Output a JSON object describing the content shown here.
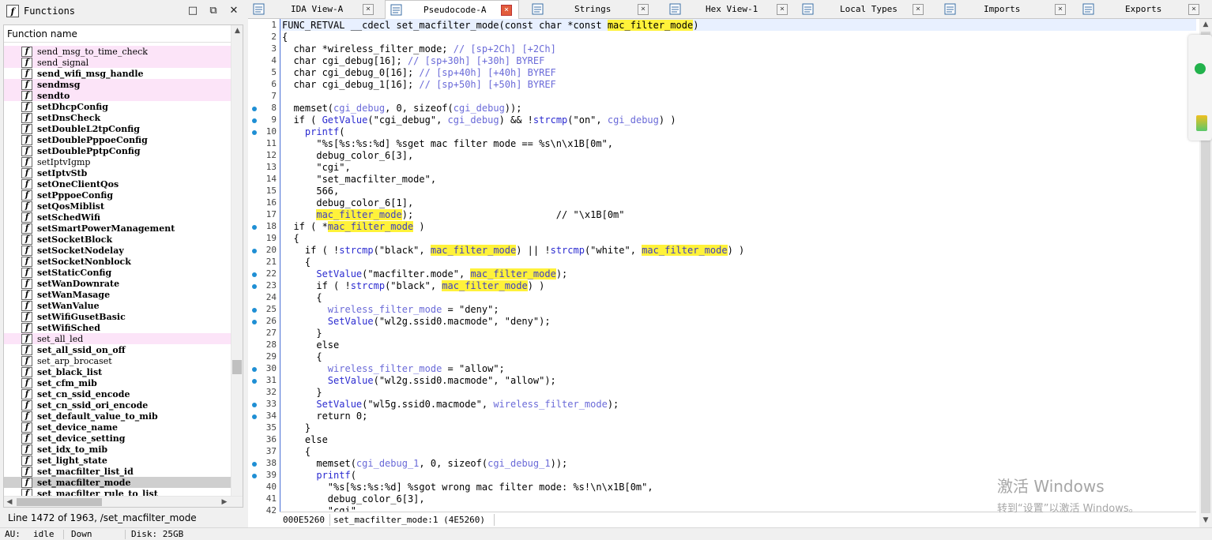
{
  "functions_panel": {
    "title": "Functions",
    "column_header": "Function name",
    "status": "Line 1472 of 1963, /set_macfilter_mode",
    "items": [
      {
        "name": "send_msg_to_time_check",
        "bold": false,
        "pink": true,
        "selected": false
      },
      {
        "name": "send_signal",
        "bold": false,
        "pink": true,
        "selected": false
      },
      {
        "name": "send_wifi_msg_handle",
        "bold": true,
        "pink": false,
        "selected": false
      },
      {
        "name": "sendmsg",
        "bold": true,
        "pink": true,
        "selected": false
      },
      {
        "name": "sendto",
        "bold": true,
        "pink": true,
        "selected": false
      },
      {
        "name": "setDhcpConfig",
        "bold": true,
        "pink": false,
        "selected": false
      },
      {
        "name": "setDnsCheck",
        "bold": true,
        "pink": false,
        "selected": false
      },
      {
        "name": "setDoubleL2tpConfig",
        "bold": true,
        "pink": false,
        "selected": false
      },
      {
        "name": "setDoublePppoeConfig",
        "bold": true,
        "pink": false,
        "selected": false
      },
      {
        "name": "setDoublePptpConfig",
        "bold": true,
        "pink": false,
        "selected": false
      },
      {
        "name": "setIptvIgmp",
        "bold": false,
        "pink": false,
        "selected": false
      },
      {
        "name": "setIptvStb",
        "bold": true,
        "pink": false,
        "selected": false
      },
      {
        "name": "setOneClientQos",
        "bold": true,
        "pink": false,
        "selected": false
      },
      {
        "name": "setPppoeConfig",
        "bold": true,
        "pink": false,
        "selected": false
      },
      {
        "name": "setQosMiblist",
        "bold": true,
        "pink": false,
        "selected": false
      },
      {
        "name": "setSchedWifi",
        "bold": true,
        "pink": false,
        "selected": false
      },
      {
        "name": "setSmartPowerManagement",
        "bold": true,
        "pink": false,
        "selected": false
      },
      {
        "name": "setSocketBlock",
        "bold": true,
        "pink": false,
        "selected": false
      },
      {
        "name": "setSocketNodelay",
        "bold": true,
        "pink": false,
        "selected": false
      },
      {
        "name": "setSocketNonblock",
        "bold": true,
        "pink": false,
        "selected": false
      },
      {
        "name": "setStaticConfig",
        "bold": true,
        "pink": false,
        "selected": false
      },
      {
        "name": "setWanDownrate",
        "bold": true,
        "pink": false,
        "selected": false
      },
      {
        "name": "setWanMasage",
        "bold": true,
        "pink": false,
        "selected": false
      },
      {
        "name": "setWanValue",
        "bold": true,
        "pink": false,
        "selected": false
      },
      {
        "name": "setWifiGusetBasic",
        "bold": true,
        "pink": false,
        "selected": false
      },
      {
        "name": "setWifiSched",
        "bold": true,
        "pink": false,
        "selected": false
      },
      {
        "name": "set_all_led",
        "bold": false,
        "pink": true,
        "selected": false
      },
      {
        "name": "set_all_ssid_on_off",
        "bold": true,
        "pink": false,
        "selected": false
      },
      {
        "name": "set_arp_brocaset",
        "bold": false,
        "pink": false,
        "selected": false
      },
      {
        "name": "set_black_list",
        "bold": true,
        "pink": false,
        "selected": false
      },
      {
        "name": "set_cfm_mib",
        "bold": true,
        "pink": false,
        "selected": false
      },
      {
        "name": "set_cn_ssid_encode",
        "bold": true,
        "pink": false,
        "selected": false
      },
      {
        "name": "set_cn_ssid_ori_encode",
        "bold": true,
        "pink": false,
        "selected": false
      },
      {
        "name": "set_default_value_to_mib",
        "bold": true,
        "pink": false,
        "selected": false
      },
      {
        "name": "set_device_name",
        "bold": true,
        "pink": false,
        "selected": false
      },
      {
        "name": "set_device_setting",
        "bold": true,
        "pink": false,
        "selected": false
      },
      {
        "name": "set_idx_to_mib",
        "bold": true,
        "pink": false,
        "selected": false
      },
      {
        "name": "set_light_state",
        "bold": true,
        "pink": false,
        "selected": false
      },
      {
        "name": "set_macfilter_list_id",
        "bold": true,
        "pink": false,
        "selected": false
      },
      {
        "name": "set_macfilter_mode",
        "bold": true,
        "pink": false,
        "selected": true
      },
      {
        "name": "set_macfilter_rule_to_list",
        "bold": true,
        "pink": false,
        "selected": false
      }
    ]
  },
  "tabs": [
    {
      "label": "IDA View-A",
      "icon": "ida-view-icon",
      "active": false
    },
    {
      "label": "Pseudocode-A",
      "icon": "pseudocode-icon",
      "active": true
    },
    {
      "label": "Strings",
      "icon": "strings-icon",
      "active": false
    },
    {
      "label": "Hex View-1",
      "icon": "hex-view-icon",
      "active": false
    },
    {
      "label": "Local Types",
      "icon": "local-types-icon",
      "active": false
    },
    {
      "label": "Imports",
      "icon": "imports-icon",
      "active": false
    },
    {
      "label": "Exports",
      "icon": "exports-icon",
      "active": false
    }
  ],
  "code": {
    "lines": [
      {
        "n": "1",
        "dot": false,
        "html": "FUNC_RETVAL __cdecl set_macfilter_mode(const char *const <span class='hlf'>mac_filter_mode</span>)"
      },
      {
        "n": "2",
        "dot": false,
        "html": "{"
      },
      {
        "n": "3",
        "dot": false,
        "html": "  char *wireless_filter_mode; <span class='c'>// [sp+2Ch] [+2Ch]</span>"
      },
      {
        "n": "4",
        "dot": false,
        "html": "  char cgi_debug[16]; <span class='c'>// [sp+30h] [+30h] BYREF</span>"
      },
      {
        "n": "5",
        "dot": false,
        "html": "  char cgi_debug_0[16]; <span class='c'>// [sp+40h] [+40h] BYREF</span>"
      },
      {
        "n": "6",
        "dot": false,
        "html": "  char cgi_debug_1[16]; <span class='c'>// [sp+50h] [+50h] BYREF</span>"
      },
      {
        "n": "7",
        "dot": false,
        "html": ""
      },
      {
        "n": "8",
        "dot": true,
        "html": "  memset(<span class='v'>cgi_debug</span>, 0, sizeof(<span class='v'>cgi_debug</span>));"
      },
      {
        "n": "9",
        "dot": true,
        "html": "  if ( <span class='f'>GetValue</span>(\"cgi_debug\", <span class='v'>cgi_debug</span>) &amp;&amp; !<span class='f'>strcmp</span>(\"on\", <span class='v'>cgi_debug</span>) )"
      },
      {
        "n": "10",
        "dot": true,
        "html": "    <span class='f'>printf</span>("
      },
      {
        "n": "11",
        "dot": false,
        "html": "      \"%s[%s:%s:%d] %sget mac filter mode == %s\\n\\x1B[0m\","
      },
      {
        "n": "12",
        "dot": false,
        "html": "      debug_color_6[3],"
      },
      {
        "n": "13",
        "dot": false,
        "html": "      \"cgi\","
      },
      {
        "n": "14",
        "dot": false,
        "html": "      \"set_macfilter_mode\","
      },
      {
        "n": "15",
        "dot": false,
        "html": "      566,"
      },
      {
        "n": "16",
        "dot": false,
        "html": "      debug_color_6[1],"
      },
      {
        "n": "17",
        "dot": false,
        "html": "      <span class='hl'>mac_filter_mode</span>);                         // \"\\x1B[0m\""
      },
      {
        "n": "18",
        "dot": true,
        "html": "  if ( *<span class='hl'>mac_filter_mode</span> )"
      },
      {
        "n": "19",
        "dot": false,
        "html": "  {"
      },
      {
        "n": "20",
        "dot": true,
        "html": "    if ( !<span class='f'>strcmp</span>(\"black\", <span class='hl'>mac_filter_mode</span>) || !<span class='f'>strcmp</span>(\"white\", <span class='hl'>mac_filter_mode</span>) )"
      },
      {
        "n": "21",
        "dot": false,
        "html": "    {"
      },
      {
        "n": "22",
        "dot": true,
        "html": "      <span class='f'>SetValue</span>(\"macfilter.mode\", <span class='hl'>mac_filter_mode</span>);"
      },
      {
        "n": "23",
        "dot": true,
        "html": "      if ( !<span class='f'>strcmp</span>(\"black\", <span class='hl'>mac_filter_mode</span>) )"
      },
      {
        "n": "24",
        "dot": false,
        "html": "      {"
      },
      {
        "n": "25",
        "dot": true,
        "html": "        <span class='v'>wireless_filter_mode</span> = \"deny\";"
      },
      {
        "n": "26",
        "dot": true,
        "html": "        <span class='f'>SetValue</span>(\"wl2g.ssid0.macmode\", \"deny\");"
      },
      {
        "n": "27",
        "dot": false,
        "html": "      }"
      },
      {
        "n": "28",
        "dot": false,
        "html": "      else"
      },
      {
        "n": "29",
        "dot": false,
        "html": "      {"
      },
      {
        "n": "30",
        "dot": true,
        "html": "        <span class='v'>wireless_filter_mode</span> = \"allow\";"
      },
      {
        "n": "31",
        "dot": true,
        "html": "        <span class='f'>SetValue</span>(\"wl2g.ssid0.macmode\", \"allow\");"
      },
      {
        "n": "32",
        "dot": false,
        "html": "      }"
      },
      {
        "n": "33",
        "dot": true,
        "html": "      <span class='f'>SetValue</span>(\"wl5g.ssid0.macmode\", <span class='v'>wireless_filter_mode</span>);"
      },
      {
        "n": "34",
        "dot": true,
        "html": "      return 0;"
      },
      {
        "n": "35",
        "dot": false,
        "html": "    }"
      },
      {
        "n": "36",
        "dot": false,
        "html": "    else"
      },
      {
        "n": "37",
        "dot": false,
        "html": "    {"
      },
      {
        "n": "38",
        "dot": true,
        "html": "      memset(<span class='v'>cgi_debug_1</span>, 0, sizeof(<span class='v'>cgi_debug_1</span>));"
      },
      {
        "n": "39",
        "dot": true,
        "html": "      <span class='f'>printf</span>("
      },
      {
        "n": "40",
        "dot": false,
        "html": "        \"%s[%s:%s:%d] %sgot wrong mac filter mode: %s!\\n\\x1B[0m\","
      },
      {
        "n": "41",
        "dot": false,
        "html": "        debug_color_6[3],"
      },
      {
        "n": "42",
        "dot": false,
        "html": "        \"cgi\","
      }
    ],
    "status_address": "000E5260",
    "status_location": "set_macfilter_mode:1 (4E5260)"
  },
  "bottom_status": {
    "au_label": "AU:",
    "au_value": "idle",
    "direction": "Down",
    "disk": "Disk: 25GB"
  },
  "watermark": {
    "line1": "激活 Windows",
    "line2": "转到“设置”以激活 Windows。"
  },
  "colors": {
    "highlight": "#fff23a",
    "breakpoint_dot": "#1f8fd4",
    "active_tab_close": "#e25c3c"
  }
}
